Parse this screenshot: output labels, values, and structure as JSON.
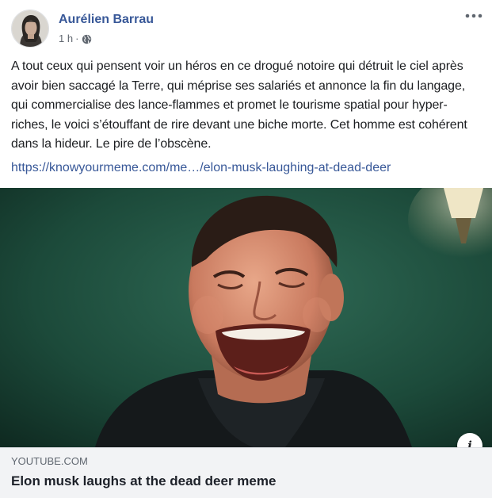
{
  "post": {
    "author_name": "Aurélien Barrau",
    "timestamp": "1 h",
    "separator": "·",
    "privacy_icon": "globe-icon",
    "more_icon": "more-options-icon",
    "body": "A tout ceux qui pensent voir un héros en ce drogué notoire qui détruit le ciel après avoir bien saccagé la Terre, qui méprise ses salariés et annonce la fin du langage, qui commercialise des lance-flammes et promet le tourisme spatial pour hyper-riches, le voici s’étouffant de rire devant une biche morte. Cet homme est cohérent dans la hideur. Le pire de l’obscène.",
    "link_text": "https://knowyourmeme.com/me…/elon-musk-laughing-at-dead-deer"
  },
  "preview": {
    "info_label": "i",
    "domain": "YOUTUBE.COM",
    "title": "Elon musk laughs at the dead deer meme"
  },
  "colors": {
    "author": "#385898",
    "link": "#385898",
    "text": "#1c1e21",
    "meta": "#616770",
    "footer_bg": "#f2f3f5"
  }
}
